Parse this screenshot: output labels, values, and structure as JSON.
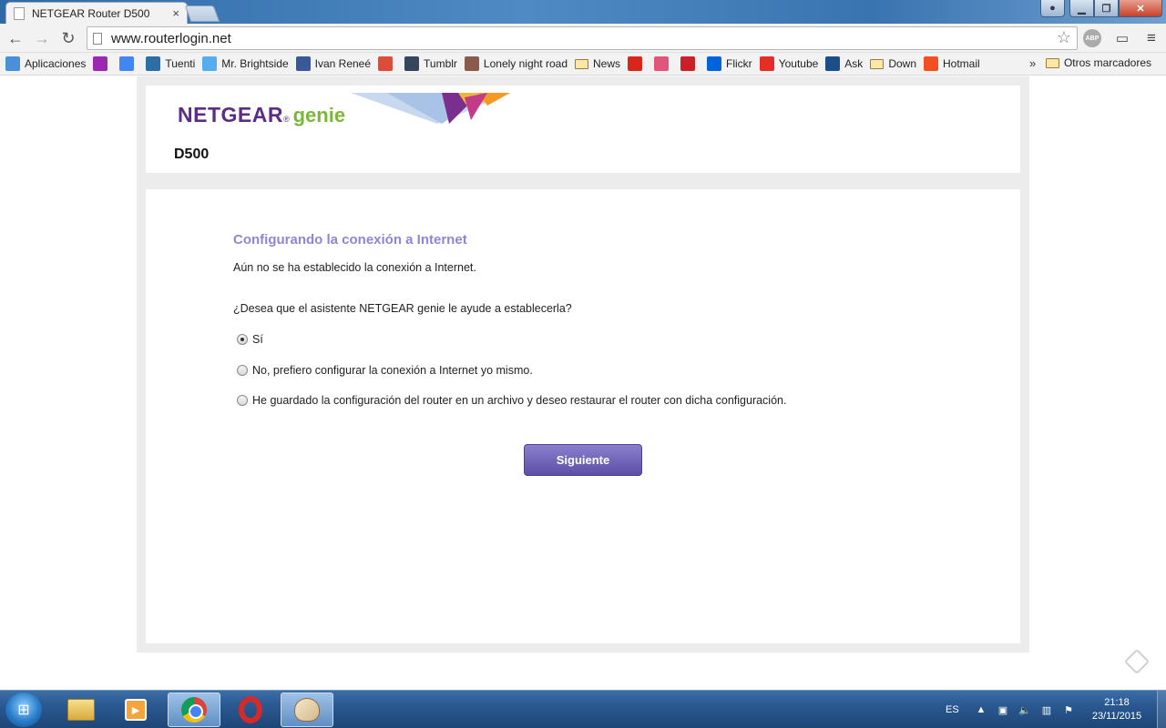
{
  "browser": {
    "tab_title": "NETGEAR Router D500",
    "tab_close": "×",
    "url": "www.routerlogin.net",
    "abp_label": "ABP",
    "bookmarks": [
      {
        "label": "Aplicaciones",
        "icon": "apps-grid-icon",
        "color": "#4a90d9"
      },
      {
        "label": "",
        "icon": "colorful-grid-icon",
        "color": "#9c27b0"
      },
      {
        "label": "",
        "icon": "google-icon",
        "color": "#4285f4"
      },
      {
        "label": "Tuenti",
        "icon": "tuenti-icon",
        "color": "#2e6ea6"
      },
      {
        "label": "Mr. Brightside",
        "icon": "twitter-icon",
        "color": "#55acee"
      },
      {
        "label": "Ivan Reneé",
        "icon": "facebook-icon",
        "color": "#3b5998"
      },
      {
        "label": "",
        "icon": "google-plus-icon",
        "color": "#dd4b39"
      },
      {
        "label": "Tumblr",
        "icon": "tumblr-icon",
        "color": "#35465c"
      },
      {
        "label": "Lonely night road",
        "icon": "photo-icon",
        "color": "#8a5a4a"
      },
      {
        "label": "News",
        "icon": "folder-icon",
        "color": ""
      },
      {
        "label": "",
        "icon": "upload-arrow-icon",
        "color": "#d9261c"
      },
      {
        "label": "",
        "icon": "heart-icon",
        "color": "#e2557a"
      },
      {
        "label": "",
        "icon": "pinterest-icon",
        "color": "#cb2027"
      },
      {
        "label": "Flickr",
        "icon": "flickr-icon",
        "color": "#0063dc"
      },
      {
        "label": "Youtube",
        "icon": "youtube-icon",
        "color": "#e52d27"
      },
      {
        "label": "Ask",
        "icon": "ask-icon",
        "color": "#1c4e8a"
      },
      {
        "label": "Down",
        "icon": "folder-icon",
        "color": ""
      },
      {
        "label": "Hotmail",
        "icon": "windows-icon",
        "color": "#f25022"
      }
    ],
    "more": "»",
    "other_bookmarks": "Otros marcadores"
  },
  "page": {
    "brand_netgear": "NETGEAR",
    "brand_reg": "®",
    "brand_genie": "genie",
    "model": "D500",
    "title": "Configurando la conexión a Internet",
    "status": "Aún no se ha establecido la conexión a Internet.",
    "question": "¿Desea que el asistente NETGEAR genie le ayude a establecerla?",
    "options": [
      {
        "label": "Sí",
        "checked": true
      },
      {
        "label": "No, prefiero configurar la conexión a Internet yo mismo.",
        "checked": false
      },
      {
        "label": "He guardado la configuración del router en un archivo y deseo restaurar el router con dicha configuración.",
        "checked": false
      }
    ],
    "next_button": "Siguiente",
    "colors": {
      "title": "#8e86d4",
      "button": "#5c4fa6",
      "brand_purple": "#5a2d86",
      "brand_green": "#7cb63a"
    }
  },
  "taskbar": {
    "language": "ES",
    "time": "21:18",
    "date": "23/11/2015"
  }
}
